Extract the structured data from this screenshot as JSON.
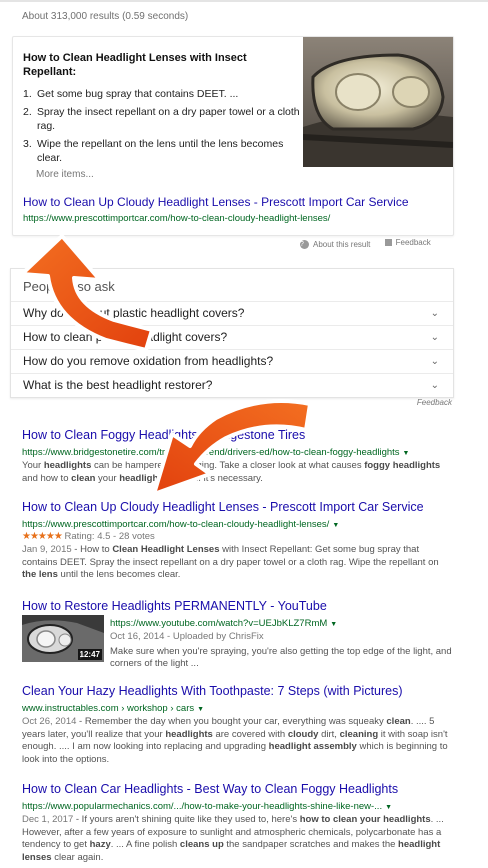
{
  "stats": "About 313,000 results (0.59 seconds)",
  "featured_snippet": {
    "title": "How to Clean Headlight Lenses with Insect Repellant:",
    "steps": [
      {
        "num": "1.",
        "text": "Get some bug spray that contains DEET. ..."
      },
      {
        "num": "2.",
        "text": "Spray the insect repellant on a dry paper towel or a cloth rag."
      },
      {
        "num": "3.",
        "text": "Wipe the repellant on the lens until the lens becomes clear."
      }
    ],
    "more_items": "More items...",
    "link_title": "How to Clean Up Cloudy Headlight Lenses - Prescott Import Car Service",
    "link_url": "https://www.prescottimportcar.com/how-to-clean-cloudy-headlight-lenses/",
    "about": "About this result",
    "feedback": "Feedback"
  },
  "people_also_ask": {
    "title": "People also ask",
    "questions": [
      "Why do they put plastic headlight covers?",
      "How to clean plastic headlight covers?",
      "How do you remove oxidation from headlights?",
      "What is the best headlight restorer?"
    ],
    "feedback": "Feedback"
  },
  "results": [
    {
      "title": "How to Clean Foggy Headlights | Bridgestone Tires",
      "url": "https://www.bridgestonetire.com/tread-and-trend/drivers-ed/how-to-clean-foggy-headlights",
      "snippet_parts": [
        {
          "t": "Your ",
          "b": false
        },
        {
          "t": "headlights",
          "b": true
        },
        {
          "t": " can be hampered by fogging. Take a closer look at what causes ",
          "b": false
        },
        {
          "t": "foggy headlights",
          "b": true
        },
        {
          "t": " and how to ",
          "b": false
        },
        {
          "t": "clean",
          "b": true
        },
        {
          "t": " your ",
          "b": false
        },
        {
          "t": "headlight lenses",
          "b": true
        },
        {
          "t": " if it's necessary.",
          "b": false
        }
      ]
    },
    {
      "title": "How to Clean Up Cloudy Headlight Lenses - Prescott Import Car Service",
      "url": "https://www.prescottimportcar.com/how-to-clean-cloudy-headlight-lenses/",
      "stars": "★★★★★",
      "rating": "Rating: 4.5 - 28 votes",
      "rating_value": 4.5,
      "date": "Jan 9, 2015",
      "snippet_parts": [
        {
          "t": " - How to ",
          "b": false
        },
        {
          "t": "Clean Headlight Lenses",
          "b": true
        },
        {
          "t": " with Insect Repellant: Get some bug spray that contains DEET. Spray the insect repellant on a dry paper towel or a cloth rag. Wipe the repellant on ",
          "b": false
        },
        {
          "t": "the lens",
          "b": true
        },
        {
          "t": " until the lens becomes clear.",
          "b": false
        }
      ]
    },
    {
      "title": "How to Restore Headlights PERMANENTLY - YouTube",
      "url": "https://www.youtube.com/watch?v=UEJbKLZ7RmM",
      "duration": "12:47",
      "meta": "Oct 16, 2014 - Uploaded by ChrisFix",
      "snippet": "Make sure when you're spraying, you're also getting the top edge of the light, and corners of the light ..."
    },
    {
      "title": "Clean Your Hazy Headlights With Toothpaste: 7 Steps (with Pictures)",
      "url": "www.instructables.com › workshop › cars",
      "date": "Oct 26, 2014",
      "snippet_parts": [
        {
          "t": " - Remember the day when you bought your car, everything was squeaky ",
          "b": false
        },
        {
          "t": "clean",
          "b": true
        },
        {
          "t": ". .... 5 years later, you'll realize that your ",
          "b": false
        },
        {
          "t": "headlights",
          "b": true
        },
        {
          "t": " are covered with ",
          "b": false
        },
        {
          "t": "cloudy",
          "b": true
        },
        {
          "t": " dirt, ",
          "b": false
        },
        {
          "t": "cleaning",
          "b": true
        },
        {
          "t": " it with soap isn't enough. .... I am now looking into replacing and upgrading ",
          "b": false
        },
        {
          "t": "headlight assembly",
          "b": true
        },
        {
          "t": " which is beginning to look into the options.",
          "b": false
        }
      ]
    },
    {
      "title": "How to Clean Car Headlights - Best Way to Clean Foggy Headlights",
      "url": "https://www.popularmechanics.com/.../how-to-make-your-headlights-shine-like-new-...",
      "date": "Dec 1, 2017",
      "snippet_parts": [
        {
          "t": " - If yours aren't shining quite like they used to, here's ",
          "b": false
        },
        {
          "t": "how to clean your headlights",
          "b": true
        },
        {
          "t": ". ... However, after a few years of exposure to sunlight and atmospheric chemicals, polycarbonate has a tendency to get ",
          "b": false
        },
        {
          "t": "hazy",
          "b": true
        },
        {
          "t": ". ... A fine polish ",
          "b": false
        },
        {
          "t": "cleans up",
          "b": true
        },
        {
          "t": " the sandpaper scratches and makes the ",
          "b": false
        },
        {
          "t": "headlight lenses",
          "b": true
        },
        {
          "t": " clear again.",
          "b": false
        }
      ]
    }
  ],
  "colors": {
    "link": "#1a0dab",
    "url": "#006621",
    "arrow": "#f05a14",
    "star": "#e7711b"
  }
}
